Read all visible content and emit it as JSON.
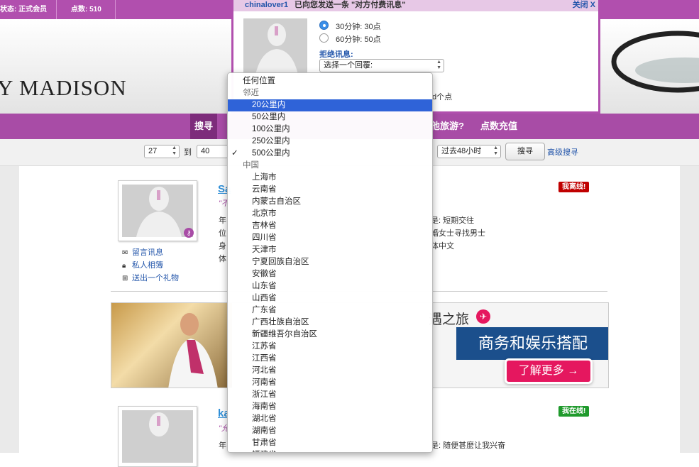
{
  "topbar": {
    "status_label": "状态: 正式会员",
    "points_label": "点数: 510"
  },
  "logo": {
    "text": "Y MADISON"
  },
  "nav": {
    "search": "搜寻",
    "travel": "他旅游?",
    "recharge": "点数充值"
  },
  "filter": {
    "age_min": "27",
    "to_label": "到",
    "age_max": "40",
    "time_range": "过去48小时",
    "search_button": "搜寻",
    "advanced_search": "高级搜寻"
  },
  "dialog": {
    "sender": "chinalover1",
    "message": "已向您发送一条 \"对方付费讯息\"",
    "close": "关闭 X",
    "option1": "30分钟: 30点",
    "option2": "60分钟: 50点",
    "reject_label": "拒绝讯息:",
    "reply_select": "选择一个回覆:",
    "remaining_text": "d个点"
  },
  "location_menu": {
    "items": [
      {
        "label": "任何位置",
        "kind": "option"
      },
      {
        "label": "邻近",
        "kind": "group"
      },
      {
        "label": "20公里内",
        "kind": "option",
        "indent": true,
        "highlighted": true
      },
      {
        "label": "50公里内",
        "kind": "option",
        "indent": true
      },
      {
        "label": "100公里内",
        "kind": "option",
        "indent": true
      },
      {
        "label": "250公里内",
        "kind": "option",
        "indent": true
      },
      {
        "label": "500公里内",
        "kind": "option",
        "indent": true,
        "checked": true
      },
      {
        "label": "中国",
        "kind": "group"
      },
      {
        "label": "上海市",
        "kind": "option",
        "indent": true
      },
      {
        "label": "云南省",
        "kind": "option",
        "indent": true
      },
      {
        "label": "内蒙古自治区",
        "kind": "option",
        "indent": true
      },
      {
        "label": "北京市",
        "kind": "option",
        "indent": true
      },
      {
        "label": "吉林省",
        "kind": "option",
        "indent": true
      },
      {
        "label": "四川省",
        "kind": "option",
        "indent": true
      },
      {
        "label": "天津市",
        "kind": "option",
        "indent": true
      },
      {
        "label": "宁夏回族自治区",
        "kind": "option",
        "indent": true
      },
      {
        "label": "安徽省",
        "kind": "option",
        "indent": true
      },
      {
        "label": "山东省",
        "kind": "option",
        "indent": true
      },
      {
        "label": "山西省",
        "kind": "option",
        "indent": true
      },
      {
        "label": "广东省",
        "kind": "option",
        "indent": true
      },
      {
        "label": "广西壮族自治区",
        "kind": "option",
        "indent": true
      },
      {
        "label": "新疆维吾尔自治区",
        "kind": "option",
        "indent": true
      },
      {
        "label": "江苏省",
        "kind": "option",
        "indent": true
      },
      {
        "label": "江西省",
        "kind": "option",
        "indent": true
      },
      {
        "label": "河北省",
        "kind": "option",
        "indent": true
      },
      {
        "label": "河南省",
        "kind": "option",
        "indent": true
      },
      {
        "label": "浙江省",
        "kind": "option",
        "indent": true
      },
      {
        "label": "海南省",
        "kind": "option",
        "indent": true
      },
      {
        "label": "湖北省",
        "kind": "option",
        "indent": true
      },
      {
        "label": "湖南省",
        "kind": "option",
        "indent": true
      },
      {
        "label": "甘肃省",
        "kind": "option",
        "indent": true
      },
      {
        "label": "福建省",
        "kind": "option",
        "indent": true
      }
    ]
  },
  "profile1": {
    "name": "Sa",
    "quote": "\"不",
    "status_badge": "我离线!",
    "actions": [
      "留言讯息",
      "私人相簿",
      "送出一个礼物"
    ],
    "labels": [
      "年",
      "位",
      "身",
      "体"
    ],
    "info_right": [
      "是: 短期交往",
      "婚女士寻找男士",
      "体中文"
    ]
  },
  "banner": {
    "heading": "遇之旅",
    "tagline": "商务和娱乐搭配",
    "cta": "了解更多 →"
  },
  "profile2": {
    "name": "ka",
    "quote": "\"允",
    "status_badge": "我在线!",
    "labels": [
      "年"
    ],
    "info_right": "是: 随便甚麼让我兴奋"
  },
  "colors": {
    "brand_purple": "#a84ca6",
    "menu_highlight": "#2f63d8",
    "offline_red": "#c00000",
    "online_green": "#1f9a2c",
    "banner_blue": "#1b4f8c",
    "cta_pink": "#e5175f"
  },
  "icons": {
    "close": "close-icon",
    "airplane": "airplane-icon",
    "envelope": "envelope-icon",
    "lock": "lock-icon",
    "gift": "gift-icon",
    "key": "key-icon",
    "checkmark": "checkmark-icon"
  }
}
